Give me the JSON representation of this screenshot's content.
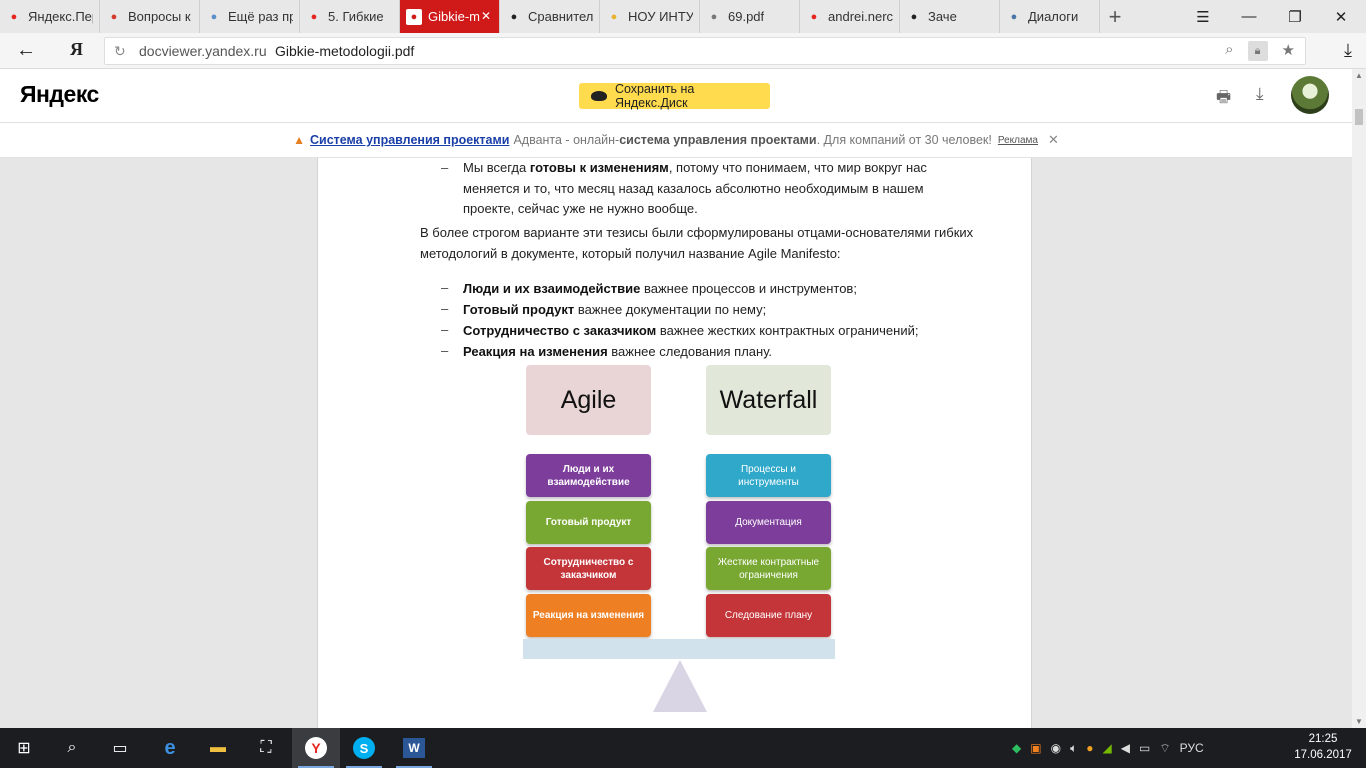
{
  "tabs": [
    {
      "label": "Яндекс.Пер",
      "icon": "yandex-browser-icon",
      "color": "#e52620"
    },
    {
      "label": "Вопросы к",
      "icon": "gmail-icon",
      "color": "#d33b2c"
    },
    {
      "label": "Ещё раз пр",
      "icon": "h-site-icon",
      "color": "#5b8fc7"
    },
    {
      "label": "5. Гибкие",
      "icon": "yandex-icon",
      "color": "#e52620"
    },
    {
      "label": "Gibkie-m",
      "icon": "pdf-icon",
      "color": "#ffffff",
      "active": true
    },
    {
      "label": "Сравнител",
      "icon": "github-icon",
      "color": "#222222"
    },
    {
      "label": "НОУ ИНТУ",
      "icon": "intuit-icon",
      "color": "#e8b12e"
    },
    {
      "label": "69.pdf",
      "icon": "document-icon",
      "color": "#777777"
    },
    {
      "label": "andrei.nerc",
      "icon": "music-icon",
      "color": "#e52620"
    },
    {
      "label": "Заче",
      "icon": "play-icon",
      "color": "#222222"
    },
    {
      "label": "Диалоги",
      "icon": "chat-icon",
      "color": "#4a76a8"
    }
  ],
  "address": {
    "host": "docviewer.yandex.ru",
    "title": "Gibkie-metodologii.pdf",
    "ya_label": "Я"
  },
  "viewer": {
    "logo_main": "Яндекс",
    "save_label": "Сохранить на Яндекс.Диск"
  },
  "ad": {
    "link": "Система управления проектами",
    "text_before": "Адванта - онлайн-",
    "bold": "система управления проектами",
    "text_after": ". Для компаний от 30 человек!",
    "mark": "Реклама"
  },
  "document": {
    "item0": {
      "line1_pre": "Мы всегда ",
      "line1_bold": "готовы к изменениям",
      "line1_post": ", потому что понимаем, что мир вокруг нас",
      "line2": "меняется и то, что месяц назад казалось абсолютно необходимым в нашем",
      "line3": "проекте, сейчас уже не нужно вообще."
    },
    "para1": "В более строгом варианте эти тезисы были сформулированы отцами-основателями гибких",
    "para2": "методологий в документе, который получил название Agile Manifesto:",
    "bullets": [
      {
        "bold": "Люди и их взаимодействие",
        "text": " важнее процессов и инструментов;"
      },
      {
        "bold": "Готовый продукт",
        "text": " важнее документации по нему;"
      },
      {
        "bold": "Сотрудничество с заказчиком",
        "text": " важнее жестких контрактных ограничений;"
      },
      {
        "bold": "Реакция на изменения",
        "text": " важнее следования плану."
      }
    ],
    "dash": "–",
    "diagram": {
      "left_title": "Agile",
      "right_title": "Waterfall",
      "left_boxes": [
        {
          "label": "Люди и их взаимодействие",
          "color": "#7d3d9b"
        },
        {
          "label": "Готовый продукт",
          "color": "#79a832"
        },
        {
          "label": "Сотрудничество с заказчиком",
          "color": "#c4353a"
        },
        {
          "label": "Реакция на изменения",
          "color": "#ee7f22"
        }
      ],
      "right_boxes": [
        {
          "label": "Процессы и инструменты",
          "color": "#2fa8c9"
        },
        {
          "label": "Документация",
          "color": "#7d3d9b"
        },
        {
          "label": "Жесткие контрактные ограничения",
          "color": "#79a832"
        },
        {
          "label": "Следование плану",
          "color": "#c4353a"
        }
      ]
    }
  },
  "taskbar": {
    "lang": "РУС",
    "time": "21:25",
    "date": "17.06.2017"
  }
}
